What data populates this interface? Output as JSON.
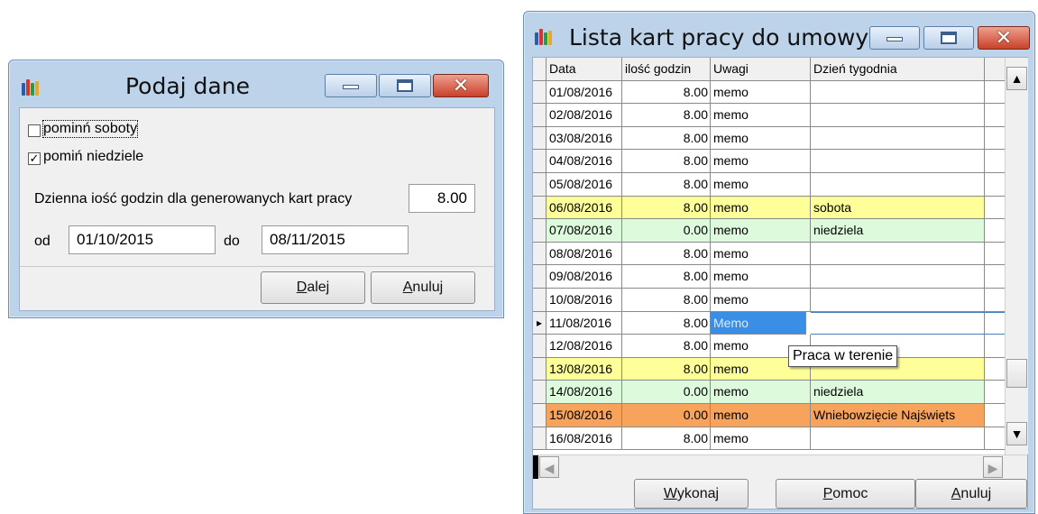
{
  "dialog": {
    "title": "Podaj dane",
    "skip_saturdays": {
      "label": "pominń soboty",
      "checked": false
    },
    "skip_sundays": {
      "label": "pomiń niedziele",
      "checked": true
    },
    "daily_hours_label": "Dzienna iość godzin dla generowanych kart pracy",
    "daily_hours_value": "8.00",
    "from_label": "od",
    "from_value": "01/10/2015",
    "to_label": "do",
    "to_value": "08/11/2015",
    "next_button": {
      "accel": "D",
      "rest": "alej"
    },
    "cancel_button": {
      "accel": "A",
      "rest": "nuluj"
    }
  },
  "list_window": {
    "title": "Lista kart pracy do umowy",
    "columns": [
      "Data",
      "ilość godzin",
      "Uwagi",
      "Dzień tygodnia"
    ],
    "rows": [
      {
        "date": "01/08/2016",
        "hours": "8.00",
        "note": "memo",
        "day": ""
      },
      {
        "date": "02/08/2016",
        "hours": "8.00",
        "note": "memo",
        "day": ""
      },
      {
        "date": "03/08/2016",
        "hours": "8.00",
        "note": "memo",
        "day": ""
      },
      {
        "date": "04/08/2016",
        "hours": "8.00",
        "note": "memo",
        "day": ""
      },
      {
        "date": "05/08/2016",
        "hours": "8.00",
        "note": "memo",
        "day": ""
      },
      {
        "date": "06/08/2016",
        "hours": "8.00",
        "note": "memo",
        "day": "sobota"
      },
      {
        "date": "07/08/2016",
        "hours": "0.00",
        "note": "memo",
        "day": "niedziela"
      },
      {
        "date": "08/08/2016",
        "hours": "8.00",
        "note": "memo",
        "day": ""
      },
      {
        "date": "09/08/2016",
        "hours": "8.00",
        "note": "memo",
        "day": ""
      },
      {
        "date": "10/08/2016",
        "hours": "8.00",
        "note": "memo",
        "day": ""
      },
      {
        "date": "11/08/2016",
        "hours": "8.00",
        "note": "Memo",
        "day": ""
      },
      {
        "date": "12/08/2016",
        "hours": "8.00",
        "note": "memo",
        "day": ""
      },
      {
        "date": "13/08/2016",
        "hours": "8.00",
        "note": "memo",
        "day": ""
      },
      {
        "date": "14/08/2016",
        "hours": "0.00",
        "note": "memo",
        "day": "niedziela"
      },
      {
        "date": "15/08/2016",
        "hours": "0.00",
        "note": "memo",
        "day": "Wniebowzięcie Najświęts"
      },
      {
        "date": "16/08/2016",
        "hours": "8.00",
        "note": "memo",
        "day": ""
      }
    ],
    "tooltip": "Praca w terenie",
    "execute_button": {
      "accel": "W",
      "rest": "ykonaj"
    },
    "help_button": {
      "accel": "P",
      "rest": "omoc"
    },
    "cancel_button": {
      "accel": "A",
      "rest": "nuluj"
    }
  },
  "colors": {
    "saturday": "#ffff99",
    "sunday": "#ddfadd",
    "holiday": "#f7a35b",
    "selected_cell": "#3a8ee6"
  }
}
